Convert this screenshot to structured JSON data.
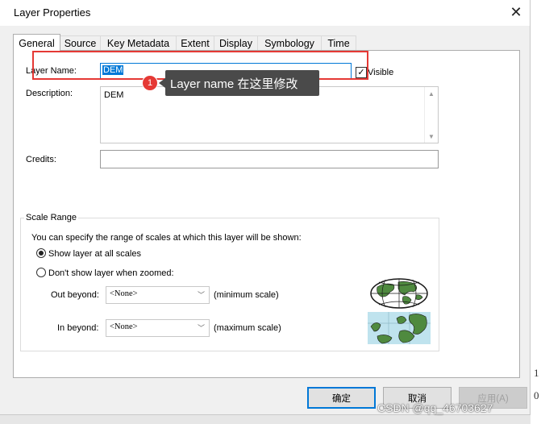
{
  "window": {
    "title": "Layer Properties",
    "close_glyph": "✕",
    "close_icon": "close-icon"
  },
  "tabs": [
    {
      "label": "General",
      "active": true
    },
    {
      "label": "Source"
    },
    {
      "label": "Key Metadata"
    },
    {
      "label": "Extent"
    },
    {
      "label": "Display"
    },
    {
      "label": "Symbology"
    },
    {
      "label": "Time"
    }
  ],
  "general": {
    "layer_name_label": "Layer Name:",
    "layer_name_value": "DEM",
    "visible_label": "Visible",
    "visible_checked": true,
    "visible_glyph": "✓",
    "description_label": "Description:",
    "description_value": "DEM",
    "credits_label": "Credits:",
    "credits_value": ""
  },
  "annotation": {
    "number": "1",
    "text": "Layer name 在这里修改",
    "highlight_color": "#e53935"
  },
  "scale_range": {
    "legend": "Scale Range",
    "intro": "You can specify the range of scales at which this layer will be shown:",
    "option_all": "Show layer at all scales",
    "option_zoomed": "Don't show layer when zoomed:",
    "selected_option": "all",
    "out_label": "Out beyond:",
    "out_value": "<None>",
    "out_hint": "(minimum scale)",
    "in_label": "In beyond:",
    "in_value": "<None>",
    "in_hint": "(maximum scale)",
    "dropdown_glyph": "﹀",
    "icons": [
      "globe-icon",
      "regional-map-icon"
    ]
  },
  "buttons": {
    "ok": "确定",
    "cancel": "取消",
    "apply": "应用(A)"
  },
  "scroll_arrows": {
    "up": "▲",
    "down": "▼"
  },
  "watermark": "CSDN @qq_46703627",
  "background_chars": [
    "1",
    "0"
  ]
}
